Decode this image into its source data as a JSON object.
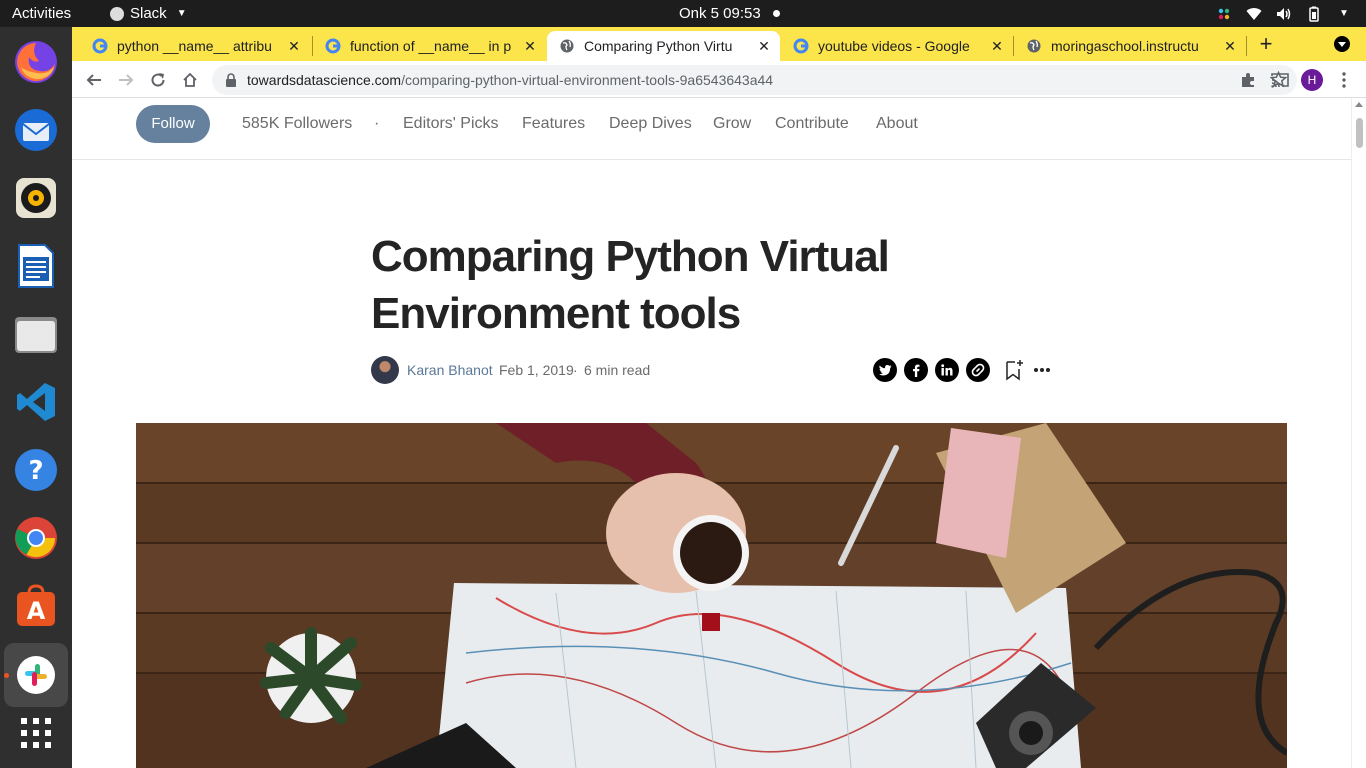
{
  "system": {
    "activities": "Activities",
    "app_name": "Slack",
    "clock": "Onk 5  09:53"
  },
  "dock": {
    "apps": [
      "Firefox",
      "Thunderbird",
      "Rhythmbox",
      "LibreOffice Writer",
      "Files",
      "Visual Studio Code",
      "Help",
      "Google Chrome",
      "Ubuntu Software",
      "Slack",
      "Show Applications"
    ]
  },
  "browser": {
    "tabs": [
      {
        "title": "python __name__ attribu",
        "active": false
      },
      {
        "title": "function of __name__ in p",
        "active": false
      },
      {
        "title": "Comparing Python Virtu",
        "active": true
      },
      {
        "title": "youtube videos - Google",
        "active": false
      },
      {
        "title": "moringaschool.instructu",
        "active": false
      }
    ],
    "new_tab": "+",
    "url_host": "towardsdatascience.com",
    "url_path": "/comparing-python-virtual-environment-tools-9a6543643a44",
    "profile_initial": "H",
    "profile_color": "#6a1b9a",
    "tabstrip_color": "#fce44b"
  },
  "page": {
    "nav": {
      "follow": "Follow",
      "followers": "585K Followers",
      "separator": "·",
      "links": [
        "Editors' Picks",
        "Features",
        "Deep Dives",
        "Grow",
        "Contribute",
        "About"
      ]
    },
    "article": {
      "title_line1": "Comparing Python Virtual",
      "title_line2": "Environment tools",
      "author": "Karan Bhanot",
      "date": "Feb 1, 2019",
      "dot": "·",
      "read_time": "6 min read"
    },
    "share_icons": [
      "twitter-icon",
      "facebook-icon",
      "linkedin-icon",
      "link-icon"
    ],
    "hero_image": "desk with map, coffee cup, camera, pen and notebook"
  }
}
